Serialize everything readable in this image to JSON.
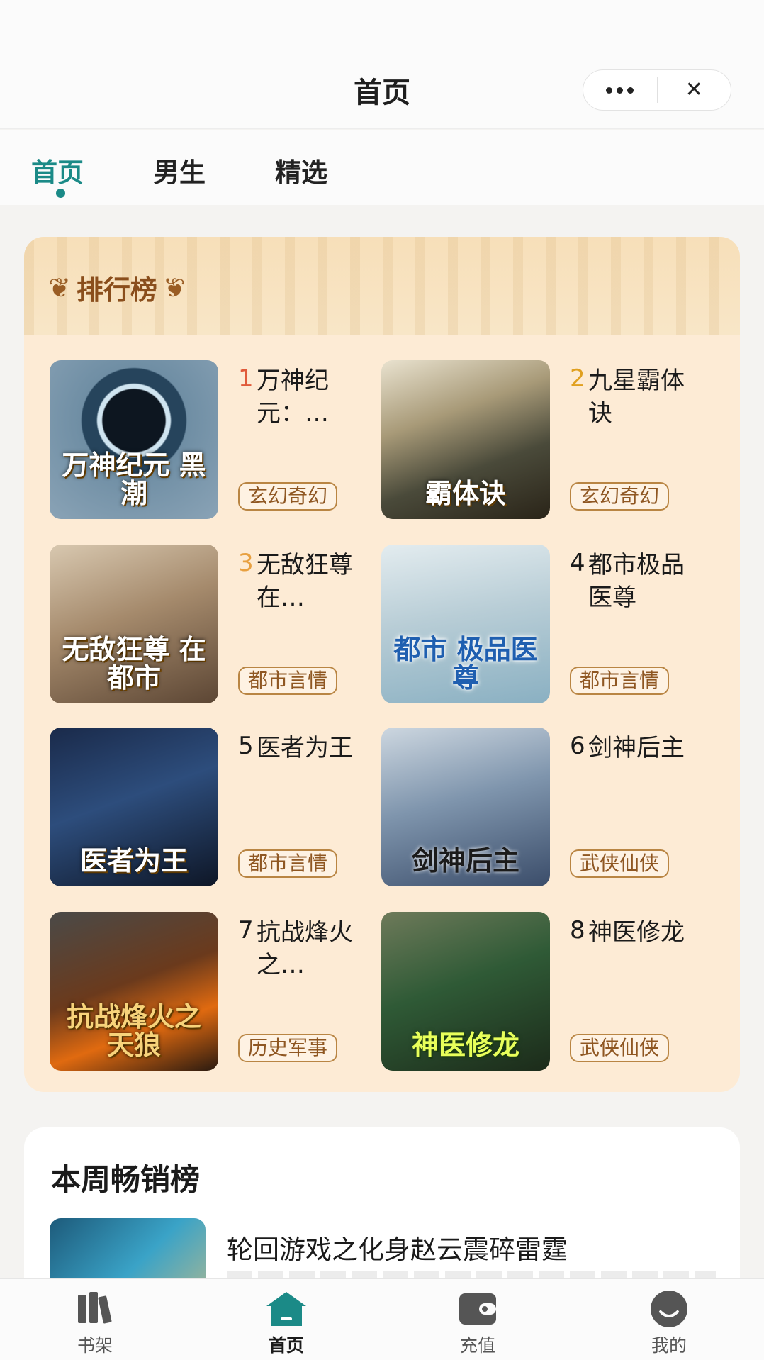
{
  "header": {
    "title": "首页",
    "more_icon": "more-dots-icon",
    "close_icon": "close-icon",
    "close_glyph": "✕"
  },
  "tabs": [
    {
      "label": "首页",
      "active": true
    },
    {
      "label": "男生",
      "active": false
    },
    {
      "label": "精选",
      "active": false
    }
  ],
  "ranking": {
    "title": "排行榜",
    "books": [
      {
        "rank": "1",
        "name": "万神纪元：…",
        "tag": "玄幻奇幻",
        "cover_text": "万神纪元 黑潮",
        "rank_color": "#e05a3a"
      },
      {
        "rank": "2",
        "name": "九星霸体诀",
        "tag": "玄幻奇幻",
        "cover_text": "霸体诀",
        "rank_color": "#e0a020"
      },
      {
        "rank": "3",
        "name": "无敌狂尊在…",
        "tag": "都市言情",
        "cover_text": "无敌狂尊 在都市",
        "rank_color": "#e8a040"
      },
      {
        "rank": "4",
        "name": "都市极品医尊",
        "tag": "都市言情",
        "cover_text": "都市 极品医尊",
        "rank_color": "#1b1b1b"
      },
      {
        "rank": "5",
        "name": "医者为王",
        "tag": "都市言情",
        "cover_text": "医者为王",
        "rank_color": "#1b1b1b"
      },
      {
        "rank": "6",
        "name": "剑神后主",
        "tag": "武侠仙侠",
        "cover_text": "剑神后主",
        "rank_color": "#1b1b1b"
      },
      {
        "rank": "7",
        "name": "抗战烽火之…",
        "tag": "历史军事",
        "cover_text": "抗战烽火之 天狼",
        "rank_color": "#1b1b1b"
      },
      {
        "rank": "8",
        "name": "神医修龙",
        "tag": "武侠仙侠",
        "cover_text": "神医修龙",
        "rank_color": "#1b1b1b"
      }
    ]
  },
  "weekly": {
    "title": "本周畅销榜",
    "first_book_name": "轮回游戏之化身赵云震碎雷霆"
  },
  "bottom_nav": [
    {
      "label": "书架",
      "icon": "bookshelf-icon",
      "active": false
    },
    {
      "label": "首页",
      "icon": "home-icon",
      "active": true
    },
    {
      "label": "充值",
      "icon": "wallet-icon",
      "active": false
    },
    {
      "label": "我的",
      "icon": "profile-icon",
      "active": false
    }
  ],
  "colors": {
    "accent": "#1b8a87",
    "rank_bg": "#fdebd5",
    "tag_border": "#b98543"
  }
}
